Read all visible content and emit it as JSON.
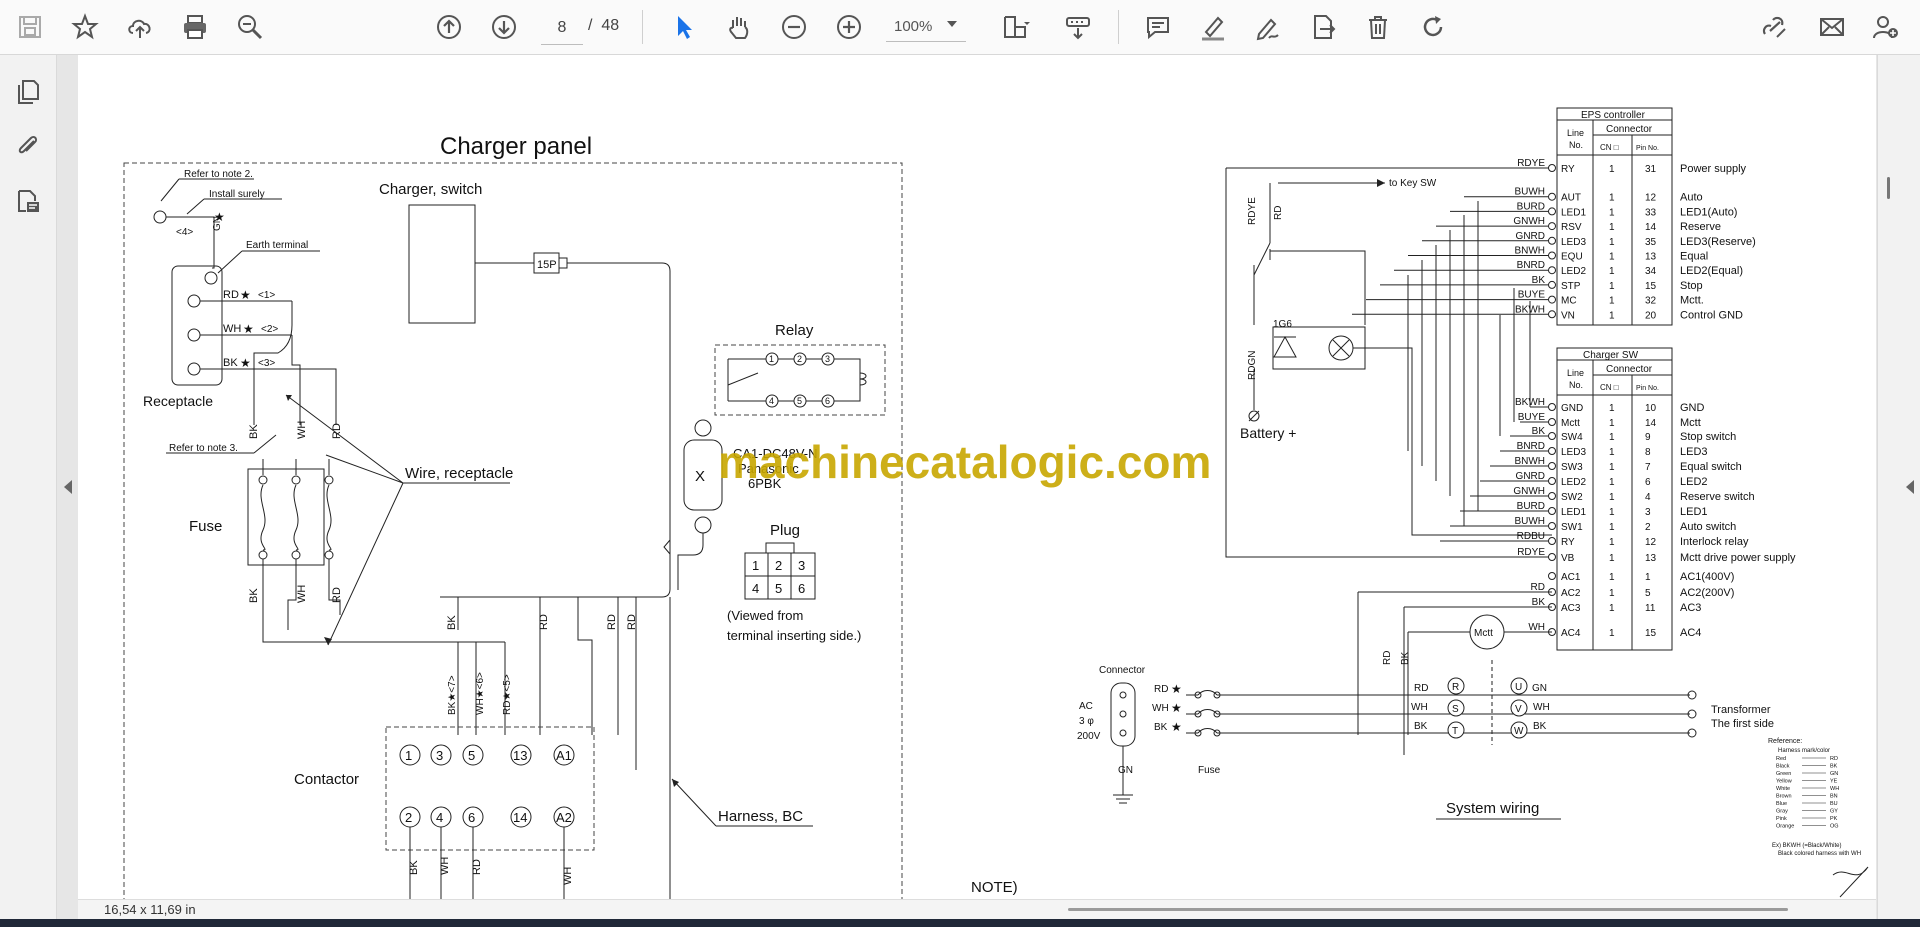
{
  "toolbar": {
    "page_current": "8",
    "page_separator": "/",
    "page_total": "48",
    "zoom": "100%",
    "tools_left": [
      "save-icon",
      "bookmark-star-icon",
      "upload-cloud-icon",
      "print-icon",
      "zoom-search-icon"
    ],
    "tools_nav": [
      "page-up-icon",
      "page-down-icon",
      "select-arrow-icon",
      "hand-icon",
      "zoom-out-icon",
      "zoom-in-icon"
    ],
    "tools_right": [
      "fit-page-icon",
      "scroll-mode-icon",
      "comment-icon",
      "highlight-icon",
      "sign-icon",
      "export-icon",
      "delete-icon",
      "rotate-icon",
      "share-link-icon",
      "email-icon",
      "add-user-icon"
    ],
    "accent_color": "#1a73e8"
  },
  "left_rail": [
    "pages-icon",
    "attachment-icon",
    "layers-icon"
  ],
  "status": {
    "page_size": "16,54 x 11,69 in"
  },
  "watermark": "machinecatalogic.com",
  "drawing": {
    "charger_panel_title": "Charger panel",
    "charger_switch": "Charger, switch",
    "connector_15p": "15P",
    "refer_note2": "Refer to note 2.",
    "install_surely": "Install surely",
    "earth_terminal": "Earth terminal",
    "earth_num": "<4>",
    "gn": "GN",
    "rec_rd": "RD",
    "rec_wh": "WH",
    "rec_bk": "BK",
    "rec_1": "<1>",
    "rec_2": "<2>",
    "rec_3": "<3>",
    "receptacle": "Receptacle",
    "refer_note3": "Refer to note 3.",
    "fuse": "Fuse",
    "wire_receptacle": "Wire, receptacle",
    "relay": "Relay",
    "relay_pins": [
      "1",
      "2",
      "3",
      "4",
      "5",
      "6"
    ],
    "relay_model1": "CA1-DC48V-N",
    "relay_model2": "Panasonic",
    "relay_model3": "6PBK",
    "relay_x": "X",
    "plug": "Plug",
    "plug_pins": [
      "1",
      "2",
      "3",
      "4",
      "5",
      "6"
    ],
    "viewed_from1": "(Viewed from",
    "viewed_from2": "terminal inserting side.)",
    "contactor": "Contactor",
    "contactor_top": [
      "1",
      "3",
      "5",
      "13",
      "A1"
    ],
    "contactor_bottom": [
      "2",
      "4",
      "6",
      "14",
      "A2"
    ],
    "cont_bk": "BK",
    "cont_wh": "WH",
    "cont_rd": "RD",
    "cont_7": "<7>",
    "cont_6": "<6>",
    "cont_5": "<5>",
    "harness_bc": "Harness, BC",
    "note": "NOTE)",
    "to_key_sw": "to Key SW",
    "rdye": "RDYE",
    "rd": "RD",
    "rdgn": "RDGN",
    "diode_1g6": "1G6",
    "battery": "Battery +",
    "eps_title": "EPS controller",
    "col_line": "Line",
    "col_no": "No.",
    "col_connector": "Connector",
    "col_cn": "CN □",
    "col_pin": "Pin No.",
    "eps_rows": [
      {
        "wire": "RDYE",
        "line": "RY",
        "cn": "1",
        "pin": "31",
        "desc": "Power supply"
      },
      {
        "wire": "BUWH",
        "line": "AUT",
        "cn": "1",
        "pin": "12",
        "desc": "Auto"
      },
      {
        "wire": "BURD",
        "line": "LED1",
        "cn": "1",
        "pin": "33",
        "desc": "LED1(Auto)"
      },
      {
        "wire": "GNWH",
        "line": "RSV",
        "cn": "1",
        "pin": "14",
        "desc": "Reserve"
      },
      {
        "wire": "GNRD",
        "line": "LED3",
        "cn": "1",
        "pin": "35",
        "desc": "LED3(Reserve)"
      },
      {
        "wire": "BNWH",
        "line": "EQU",
        "cn": "1",
        "pin": "13",
        "desc": "Equal"
      },
      {
        "wire": "BNRD",
        "line": "LED2",
        "cn": "1",
        "pin": "34",
        "desc": "LED2(Equal)"
      },
      {
        "wire": "BK",
        "line": "STP",
        "cn": "1",
        "pin": "15",
        "desc": "Stop"
      },
      {
        "wire": "BUYE",
        "line": "MC",
        "cn": "1",
        "pin": "32",
        "desc": "Mctt."
      },
      {
        "wire": "BKWH",
        "line": "VN",
        "cn": "1",
        "pin": "20",
        "desc": "Control GND"
      }
    ],
    "charger_sw_title": "Charger SW",
    "sw_rows": [
      {
        "wire": "BKWH",
        "line": "GND",
        "cn": "1",
        "pin": "10",
        "desc": "GND"
      },
      {
        "wire": "BUYE",
        "line": "Mctt",
        "cn": "1",
        "pin": "14",
        "desc": "Mctt"
      },
      {
        "wire": "BK",
        "line": "SW4",
        "cn": "1",
        "pin": "9",
        "desc": "Stop switch"
      },
      {
        "wire": "BNRD",
        "line": "LED3",
        "cn": "1",
        "pin": "8",
        "desc": "LED3"
      },
      {
        "wire": "BNWH",
        "line": "SW3",
        "cn": "1",
        "pin": "7",
        "desc": "Equal switch"
      },
      {
        "wire": "GNRD",
        "line": "LED2",
        "cn": "1",
        "pin": "6",
        "desc": "LED2"
      },
      {
        "wire": "GNWH",
        "line": "SW2",
        "cn": "1",
        "pin": "4",
        "desc": "Reserve switch"
      },
      {
        "wire": "BURD",
        "line": "LED1",
        "cn": "1",
        "pin": "3",
        "desc": "LED1"
      },
      {
        "wire": "BUWH",
        "line": "SW1",
        "cn": "1",
        "pin": "2",
        "desc": "Auto switch"
      },
      {
        "wire": "RDBU",
        "line": "RY",
        "cn": "1",
        "pin": "12",
        "desc": "Interlock relay"
      },
      {
        "wire": "RDYE",
        "line": "VB",
        "cn": "1",
        "pin": "13",
        "desc": "Mctt drive power supply"
      },
      {
        "wire": "",
        "line": "AC1",
        "cn": "1",
        "pin": "1",
        "desc": "AC1(400V)"
      },
      {
        "wire": "RD",
        "line": "AC2",
        "cn": "1",
        "pin": "5",
        "desc": "AC2(200V)"
      },
      {
        "wire": "BK",
        "line": "AC3",
        "cn": "1",
        "pin": "11",
        "desc": "AC3"
      },
      {
        "wire": "WH",
        "line": "AC4",
        "cn": "1",
        "pin": "15",
        "desc": "AC4"
      }
    ],
    "mctt": "Mctt",
    "connector": "Connector",
    "ac1": "AC",
    "ac2": "3 φ",
    "ac3": "200V",
    "sw_gn": "GN",
    "sys_fuse": "Fuse",
    "sys_rd": "RD",
    "sys_wh": "WH",
    "sys_bk": "BK",
    "phase_r": "R",
    "phase_s": "S",
    "phase_t": "T",
    "phase_u": "U",
    "phase_v": "V",
    "phase_w": "W",
    "out_gn": "GN",
    "out_wh": "WH",
    "out_bk": "BK",
    "transformer1": "Transformer",
    "transformer2": "The first side",
    "system_wiring": "System wiring",
    "reference": "Reference:",
    "ref_header": "Harness mark/color",
    "ref_rows": [
      {
        "color": "Red",
        "code": "RD"
      },
      {
        "color": "Black",
        "code": "BK"
      },
      {
        "color": "Green",
        "code": "GN"
      },
      {
        "color": "Yellow",
        "code": "YE"
      },
      {
        "color": "White",
        "code": "WH"
      },
      {
        "color": "Brown",
        "code": "BN"
      },
      {
        "color": "Blue",
        "code": "BU"
      },
      {
        "color": "Gray",
        "code": "GY"
      },
      {
        "color": "Pink",
        "code": "PK"
      },
      {
        "color": "Orange",
        "code": "OG"
      }
    ],
    "ref_ex1": "Ex) BKWH (=Black/White)",
    "ref_ex2": "Black colored harness with WH"
  }
}
